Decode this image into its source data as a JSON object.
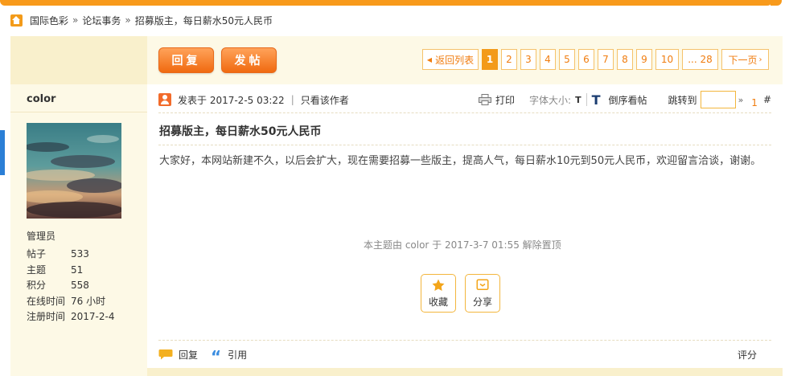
{
  "breadcrumb": {
    "items": [
      "国际色彩",
      "论坛事务",
      "招募版主，每日薪水50元人民币"
    ],
    "separator": "»"
  },
  "buttons": {
    "reply": "回复",
    "new_post": "发帖"
  },
  "pager": {
    "back": "返回列表",
    "pages": [
      "1",
      "2",
      "3",
      "4",
      "5",
      "6",
      "7",
      "8",
      "9",
      "10",
      "... 28"
    ],
    "current": "1",
    "next": "下一页"
  },
  "user": {
    "name": "color",
    "role": "管理员",
    "stats": [
      {
        "label": "帖子",
        "value": "533"
      },
      {
        "label": "主题",
        "value": "51"
      },
      {
        "label": "积分",
        "value": "558"
      },
      {
        "label": "在线时间",
        "value": "76 小时"
      },
      {
        "label": "注册时间",
        "value": "2017-2-4"
      }
    ]
  },
  "postbar": {
    "posted_at": "发表于 2017-2-5 03:22",
    "sep": "|",
    "only_author": "只看该作者",
    "print": "打印",
    "font_size": "字体大小:",
    "font_t1": "T",
    "font_t2": "T",
    "reverse": "倒序看帖",
    "jump": "跳转到",
    "jump_arrow": "»",
    "floor": "1",
    "hash": "#"
  },
  "post": {
    "title": "招募版主，每日薪水50元人民币",
    "content": "大家好，本网站新建不久，以后会扩大，现在需要招募一些版主，提高人气，每日薪水10元到50元人民币，欢迎留言洽谈，谢谢。",
    "notice": "本主题由 color 于 2017-3-7 01:55 解除置顶"
  },
  "actions": {
    "favorite": "收藏",
    "share": "分享"
  },
  "footer": {
    "reply": "回复",
    "quote": "引用",
    "rate": "评分"
  },
  "colors": {
    "accent": "#f39b1a",
    "bg_light": "#fdf9e6",
    "link_orange": "#f07d10"
  }
}
